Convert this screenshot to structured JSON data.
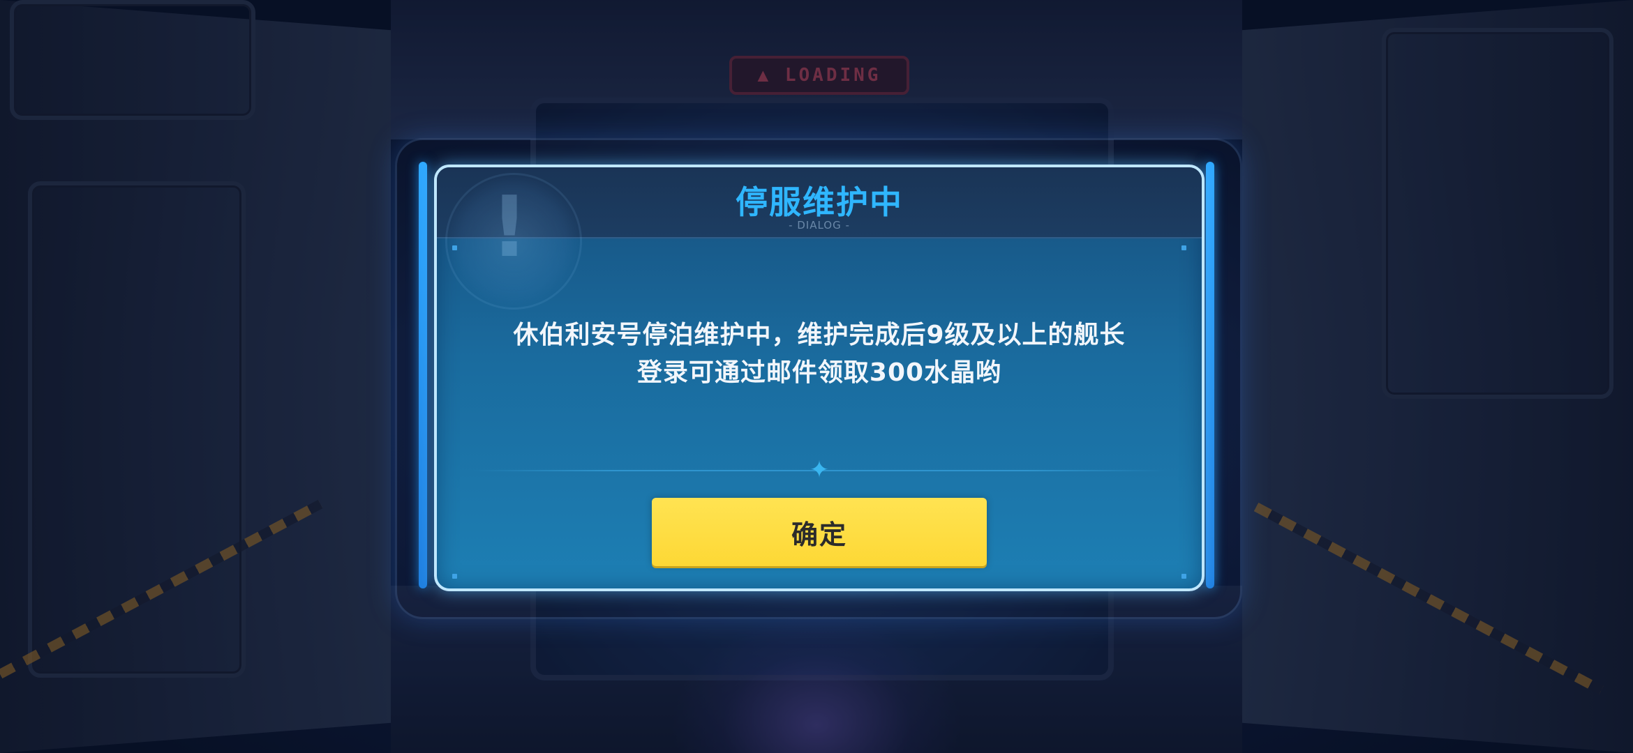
{
  "background": {
    "sign_text": "▲ LOADING"
  },
  "dialog": {
    "title": "停服维护中",
    "subtitle": "- DIALOG -",
    "warning_icon": "exclamation-icon",
    "message_line1": "休伯利安号停泊维护中，维护完成后9级及以上的舰长",
    "message_line2": "登录可通过邮件领取300水晶哟",
    "confirm_label": "确定",
    "divider_icon": "sparkle-icon"
  },
  "colors": {
    "title": "#2fb6ff",
    "button": "#fdd835",
    "dialog_border": "#bfe7ff",
    "dialog_fill": "#1a6b9e"
  }
}
